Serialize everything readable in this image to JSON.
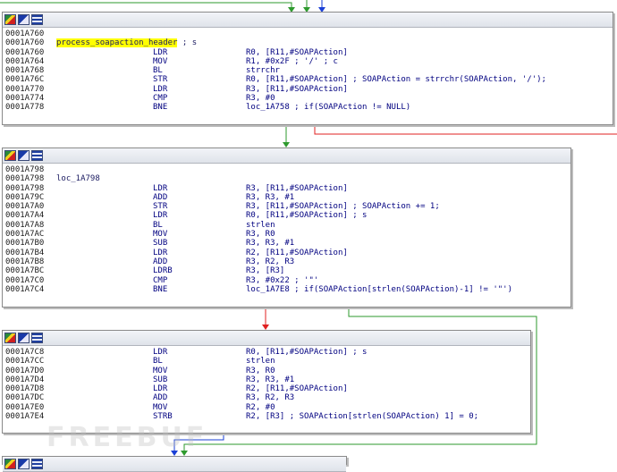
{
  "colors": {
    "edge_green": "#2e9a2e",
    "edge_red": "#e02020",
    "edge_blue": "#1a3fd6",
    "highlight": "#ffff00",
    "text": "#000080"
  },
  "toolbar_icons": [
    "graph-overview-icon",
    "edit-icon",
    "listing-icon"
  ],
  "blocks": [
    {
      "lines": [
        {
          "addr": "0001A760",
          "label": "",
          "mn": "",
          "op": ""
        },
        {
          "addr": "0001A760",
          "label": "process_soapaction_header",
          "label_cmt": " ; s",
          "highlight": true,
          "mn": "",
          "op": ""
        },
        {
          "addr": "0001A760",
          "label": "",
          "mn": "LDR",
          "op": "R0, [R11,#SOAPAction]"
        },
        {
          "addr": "0001A764",
          "label": "",
          "mn": "MOV",
          "op": "R1, #0x2F ; '/' ; c"
        },
        {
          "addr": "0001A768",
          "label": "",
          "mn": "BL",
          "op": "strrchr"
        },
        {
          "addr": "0001A76C",
          "label": "",
          "mn": "STR",
          "op": "R0, [R11,#SOAPAction] ; SOAPAction = strrchr(SOAPAction, '/');"
        },
        {
          "addr": "0001A770",
          "label": "",
          "mn": "LDR",
          "op": "R3, [R11,#SOAPAction]"
        },
        {
          "addr": "0001A774",
          "label": "",
          "mn": "CMP",
          "op": "R3, #0"
        },
        {
          "addr": "0001A778",
          "label": "",
          "mn": "BNE",
          "op": "loc_1A758 ; if(SOAPAction != NULL)"
        }
      ]
    },
    {
      "lines": [
        {
          "addr": "0001A798",
          "label": "",
          "mn": "",
          "op": ""
        },
        {
          "addr": "0001A798",
          "label": "loc_1A798",
          "mn": "",
          "op": ""
        },
        {
          "addr": "0001A798",
          "label": "",
          "mn": "LDR",
          "op": "R3, [R11,#SOAPAction]"
        },
        {
          "addr": "0001A79C",
          "label": "",
          "mn": "ADD",
          "op": "R3, R3, #1"
        },
        {
          "addr": "0001A7A0",
          "label": "",
          "mn": "STR",
          "op": "R3, [R11,#SOAPAction] ; SOAPAction += 1;"
        },
        {
          "addr": "0001A7A4",
          "label": "",
          "mn": "LDR",
          "op": "R0, [R11,#SOAPAction] ; s"
        },
        {
          "addr": "0001A7A8",
          "label": "",
          "mn": "BL",
          "op": "strlen"
        },
        {
          "addr": "0001A7AC",
          "label": "",
          "mn": "MOV",
          "op": "R3, R0"
        },
        {
          "addr": "0001A7B0",
          "label": "",
          "mn": "SUB",
          "op": "R3, R3, #1"
        },
        {
          "addr": "0001A7B4",
          "label": "",
          "mn": "LDR",
          "op": "R2, [R11,#SOAPAction]"
        },
        {
          "addr": "0001A7B8",
          "label": "",
          "mn": "ADD",
          "op": "R3, R2, R3"
        },
        {
          "addr": "0001A7BC",
          "label": "",
          "mn": "LDRB",
          "op": "R3, [R3]"
        },
        {
          "addr": "0001A7C0",
          "label": "",
          "mn": "CMP",
          "op": "R3, #0x22 ; '\"'"
        },
        {
          "addr": "0001A7C4",
          "label": "",
          "mn": "BNE",
          "op": "loc_1A7E8 ; if(SOAPAction[strlen(SOAPAction)-1] != '\"')"
        }
      ]
    },
    {
      "lines": [
        {
          "addr": "0001A7C8",
          "label": "",
          "mn": "LDR",
          "op": "R0, [R11,#SOAPAction] ; s"
        },
        {
          "addr": "0001A7CC",
          "label": "",
          "mn": "BL",
          "op": "strlen"
        },
        {
          "addr": "0001A7D0",
          "label": "",
          "mn": "MOV",
          "op": "R3, R0"
        },
        {
          "addr": "0001A7D4",
          "label": "",
          "mn": "SUB",
          "op": "R3, R3, #1"
        },
        {
          "addr": "0001A7D8",
          "label": "",
          "mn": "LDR",
          "op": "R2, [R11,#SOAPAction]"
        },
        {
          "addr": "0001A7DC",
          "label": "",
          "mn": "ADD",
          "op": "R3, R2, R3"
        },
        {
          "addr": "0001A7E0",
          "label": "",
          "mn": "MOV",
          "op": "R2, #0"
        },
        {
          "addr": "0001A7E4",
          "label": "",
          "mn": "STRB",
          "op": "R2, [R3] ; SOAPAction[strlen(SOAPAction) 1] = 0;"
        }
      ]
    },
    {
      "lines": []
    }
  ],
  "watermark": "FREEBUF"
}
